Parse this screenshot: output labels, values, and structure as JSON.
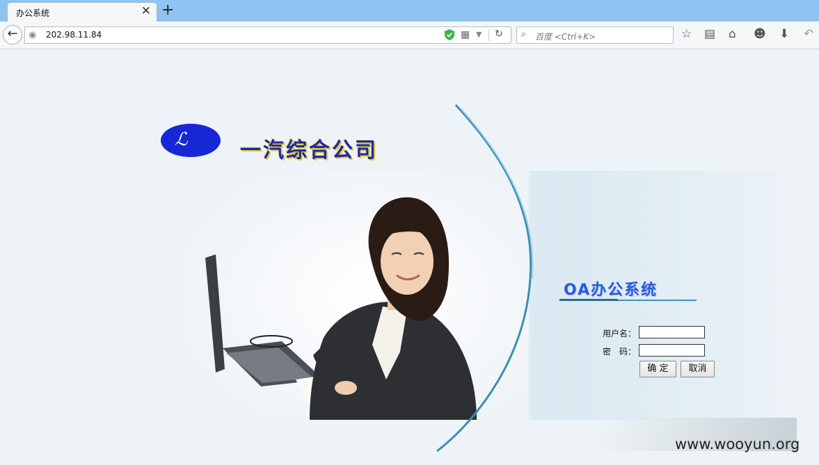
{
  "browser": {
    "tab_title": "办公系统",
    "new_tab_symbol": "+",
    "close_symbol": "✕",
    "url": "202.98.11.84",
    "search_placeholder": "百度 <Ctrl+K>"
  },
  "page": {
    "company_name": "一汽综合公司",
    "system_title": "OA办公系统",
    "username_label": "用户名：",
    "password_label": "密　码：",
    "confirm_button": "确 定",
    "cancel_button": "取消",
    "username_value": "",
    "password_value": "",
    "watermark": "www.wooyun.org"
  },
  "colors": {
    "tabbar": "#8fc4f2",
    "logo_blue": "#1628d6",
    "title_blue": "#2a5bd8",
    "arc_teal": "#3a8fb0"
  },
  "icons": [
    "back-arrow-icon",
    "globe-icon",
    "shield-icon",
    "qr-icon",
    "reload-icon",
    "search-icon",
    "star-icon",
    "reading-list-icon",
    "home-icon",
    "smile-icon",
    "download-icon",
    "undo-icon"
  ]
}
